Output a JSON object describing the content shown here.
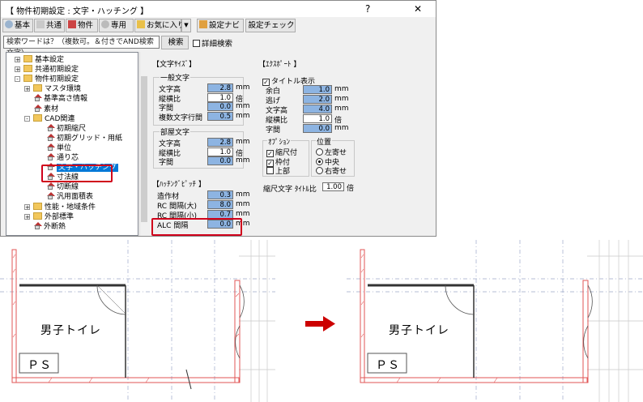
{
  "window": {
    "title": "【 物件初期設定 : 文字・ハッチング 】",
    "help": "?",
    "close": "✕"
  },
  "toolbar": {
    "buttons": [
      "基本",
      "共通",
      "物件",
      "専用",
      "お気に入り"
    ],
    "dropdown": "▼",
    "setting_navi": "設定ナビ",
    "setting_check": "設定チェック"
  },
  "search": {
    "placeholder": "検索ワードは？（複数可。＆付きでAND検索文字）",
    "button": "検索",
    "detail": "詳細検索"
  },
  "tree": {
    "items": [
      {
        "label": "基本設定",
        "icon": "folder-icon",
        "exp": "+"
      },
      {
        "label": "共通初期設定",
        "icon": "folder-icon",
        "exp": "+"
      },
      {
        "label": "物件初期設定",
        "icon": "folder-icon",
        "exp": "-"
      },
      {
        "label": "マスタ環境",
        "icon": "folder-icon",
        "exp": "+"
      },
      {
        "label": "基準高さ情報",
        "icon": "house-icon",
        "exp": ""
      },
      {
        "label": "素材",
        "icon": "house-icon",
        "exp": ""
      },
      {
        "label": "CAD関連",
        "icon": "folder-icon",
        "exp": "-"
      },
      {
        "label": "初期縮尺",
        "icon": "house-icon",
        "exp": ""
      },
      {
        "label": "初期グリッド・用紙",
        "icon": "house-icon",
        "exp": ""
      },
      {
        "label": "単位",
        "icon": "house-icon",
        "exp": ""
      },
      {
        "label": "通り芯",
        "icon": "house-icon",
        "exp": ""
      },
      {
        "label": "文字・ハッチング",
        "icon": "house-icon",
        "exp": "",
        "selected": true
      },
      {
        "label": "寸法線",
        "icon": "house-icon",
        "exp": ""
      },
      {
        "label": "切断線",
        "icon": "house-icon",
        "exp": ""
      },
      {
        "label": "汎用面積表",
        "icon": "house-icon",
        "exp": ""
      },
      {
        "label": "性能・地域条件",
        "icon": "folder-icon",
        "exp": "+"
      },
      {
        "label": "外部標準",
        "icon": "folder-icon",
        "exp": "+"
      },
      {
        "label": "外断熱",
        "icon": "house-icon",
        "exp": ""
      }
    ]
  },
  "font_size": {
    "title": "【文字ｻｲｽﾞ】",
    "general": {
      "title": "一般文字",
      "rows": [
        {
          "label": "文字高",
          "value": "2.8",
          "unit": "mm",
          "style": "blue"
        },
        {
          "label": "縦横比",
          "value": "1.0",
          "unit": "倍",
          "style": "white"
        },
        {
          "label": "字間",
          "value": "0.0",
          "unit": "mm",
          "style": "blue"
        },
        {
          "label": "複数文字行間",
          "value": "0.5",
          "unit": "mm",
          "style": "blue"
        }
      ]
    },
    "room": {
      "title": "部屋文字",
      "rows": [
        {
          "label": "文字高",
          "value": "2.8",
          "unit": "mm",
          "style": "blue"
        },
        {
          "label": "縦横比",
          "value": "1.0",
          "unit": "倍",
          "style": "white"
        },
        {
          "label": "字間",
          "value": "0.0",
          "unit": "mm",
          "style": "blue"
        }
      ]
    }
  },
  "hatch_pitch": {
    "title": "【ﾊｯﾁﾝｸﾞﾋﾟｯﾁ 】",
    "rows": [
      {
        "label": "造作材",
        "value": "0.3",
        "unit": "mm"
      },
      {
        "label": "RC 間隔(大)",
        "value": "8.0",
        "unit": "mm"
      },
      {
        "label": "RC 間隔(小)",
        "value": "0.7",
        "unit": "mm"
      },
      {
        "label": "ALC 間隔",
        "value": "0.0",
        "unit": "mm"
      }
    ]
  },
  "export": {
    "title": "【ｴｸｽﾎﾟｰﾄ 】",
    "title_display": "タイトル表示",
    "title_display_check": "✓",
    "rows": [
      {
        "label": "余白",
        "value": "1.0",
        "unit": "mm",
        "style": "blue"
      },
      {
        "label": "逃げ",
        "value": "2.0",
        "unit": "mm",
        "style": "blue"
      },
      {
        "label": "文字高",
        "value": "4.0",
        "unit": "mm",
        "style": "blue"
      },
      {
        "label": "縦横比",
        "value": "1.0",
        "unit": "倍",
        "style": "white"
      },
      {
        "label": "字間",
        "value": "0.0",
        "unit": "mm",
        "style": "blue"
      }
    ],
    "options": {
      "title": "ｵﾌﾟｼｮﾝ",
      "items": [
        {
          "label": "縮尺付",
          "checked": true,
          "mark": "✓"
        },
        {
          "label": "枠付",
          "checked": true,
          "mark": "✓"
        },
        {
          "label": "上部",
          "checked": false,
          "mark": ""
        }
      ]
    },
    "position": {
      "title": "位置",
      "items": [
        {
          "label": "左寄せ",
          "on": false
        },
        {
          "label": "中央",
          "on": true
        },
        {
          "label": "右寄せ",
          "on": false
        }
      ]
    },
    "scale_text": {
      "label1": "縮尺文字",
      "label2": "ﾀｲﾄﾙ比",
      "value": "1.00",
      "unit": "倍"
    }
  },
  "plans": {
    "room_label": "男子トイレ",
    "ps_label": "ＰＳ",
    "arrow_color": "#cc0000"
  }
}
